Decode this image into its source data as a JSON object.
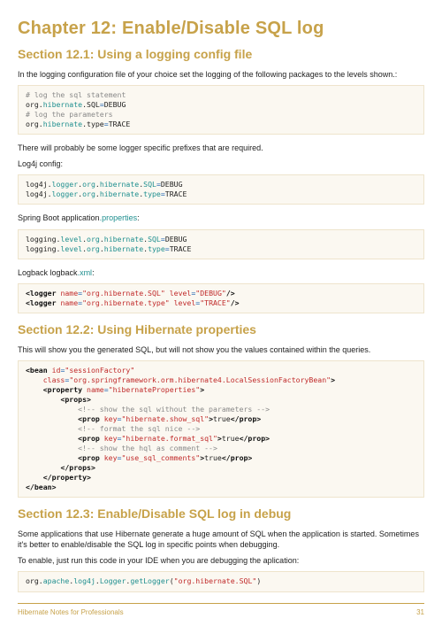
{
  "chapter": {
    "title": "Chapter 12: Enable/Disable SQL log"
  },
  "sections": {
    "s1": {
      "title": "Section 12.1: Using a logging config file",
      "p1": "In the logging configuration file of your choice set the logging of the following packages to the levels shown.:",
      "code1": {
        "l1": "# log the sql statement",
        "l2a": "org.",
        "l2b": "hibernate",
        "l2c": ".SQL",
        "l2d": "=",
        "l2e": "DEBUG",
        "l3": "# log the parameters",
        "l4a": "org.",
        "l4b": "hibernate",
        "l4c": ".type",
        "l4d": "=",
        "l4e": "TRACE"
      },
      "p2": "There will probably be some logger specific prefixes that are required.",
      "p3": "Log4j config:",
      "code2": {
        "l1a": "log4j.",
        "l1b": "logger",
        "l1c": ".",
        "l1d": "org",
        "l1e": ".",
        "l1f": "hibernate",
        "l1g": ".",
        "l1h": "SQL",
        "l1i": "=",
        "l1j": "DEBUG",
        "l2a": "log4j.",
        "l2b": "logger",
        "l2c": ".",
        "l2d": "org",
        "l2e": ".",
        "l2f": "hibernate",
        "l2g": ".",
        "l2h": "type",
        "l2i": "=",
        "l2j": "TRACE"
      },
      "p4a": "Spring Boot application",
      "p4b": ".properties",
      "p4c": ":",
      "code3": {
        "l1a": "logging.",
        "l1b": "level",
        "l1c": ".",
        "l1d": "org",
        "l1e": ".",
        "l1f": "hibernate",
        "l1g": ".",
        "l1h": "SQL",
        "l1i": "=",
        "l1j": "DEBUG",
        "l2a": "logging.",
        "l2b": "level",
        "l2c": ".",
        "l2d": "org",
        "l2e": ".",
        "l2f": "hibernate",
        "l2g": ".",
        "l2h": "type",
        "l2i": "=",
        "l2j": "TRACE"
      },
      "p5a": "Logback logback",
      "p5b": ".xml",
      "p5c": ":",
      "code4": {
        "l1a": "<logger",
        "l1b": " name",
        "l1c": "=",
        "l1d": "\"org.hibernate.SQL\"",
        "l1e": " level",
        "l1f": "=",
        "l1g": "\"DEBUG\"",
        "l1h": "/>",
        "l2a": "<logger",
        "l2b": " name",
        "l2c": "=",
        "l2d": "\"org.hibernate.type\"",
        "l2e": " level",
        "l2f": "=",
        "l2g": "\"TRACE\"",
        "l2h": "/>"
      }
    },
    "s2": {
      "title": "Section 12.2: Using Hibernate properties",
      "p1": "This will show you the generated SQL, but will not show you the values contained within the queries.",
      "code": {
        "l01a": "<bean",
        "l01b": " id",
        "l01c": "=",
        "l01d": "\"sessionFactory\"",
        "l02a": "    class",
        "l02b": "=",
        "l02c": "\"org.springframework.orm.hibernate4.LocalSessionFactoryBean\"",
        "l02d": ">",
        "l03a": "    ",
        "l03b": "<property",
        "l03c": " name",
        "l03d": "=",
        "l03e": "\"hibernateProperties\"",
        "l03f": ">",
        "l04a": "        ",
        "l04b": "<props>",
        "l05a": "            ",
        "l05b": "<!-- show the sql without the parameters -->",
        "l06a": "            ",
        "l06b": "<prop",
        "l06c": " key",
        "l06d": "=",
        "l06e": "\"hibernate.show_sql\"",
        "l06f": ">",
        "l06g": "true",
        "l06h": "</prop>",
        "l07a": "            ",
        "l07b": "<!-- format the sql nice -->",
        "l08a": "            ",
        "l08b": "<prop",
        "l08c": " key",
        "l08d": "=",
        "l08e": "\"hibernate.format_sql\"",
        "l08f": ">",
        "l08g": "true",
        "l08h": "</prop>",
        "l09a": "            ",
        "l09b": "<!-- show the hql as comment -->",
        "l10a": "            ",
        "l10b": "<prop",
        "l10c": " key",
        "l10d": "=",
        "l10e": "\"use_sql_comments\"",
        "l10f": ">",
        "l10g": "true",
        "l10h": "</prop>",
        "l11a": "        ",
        "l11b": "</props>",
        "l12a": "    ",
        "l12b": "</property>",
        "l13": "</bean>"
      }
    },
    "s3": {
      "title": "Section 12.3: Enable/Disable SQL log in debug",
      "p1": "Some applications that use Hibernate generate a huge amount of SQL when the application is started. Sometimes it's better to enable/disable the SQL log in specific points when debugging.",
      "p2": "To enable, just run this code in your IDE when you are debugging the aplication:",
      "code": {
        "l1a": "org.",
        "l1b": "apache",
        "l1c": ".",
        "l1d": "log4j",
        "l1e": ".",
        "l1f": "Logger",
        "l1g": ".",
        "l1h": "getLogger",
        "l1i": "(",
        "l1j": "\"org.hibernate.SQL\"",
        "l1k": ")"
      }
    }
  },
  "footer": {
    "left": "Hibernate Notes for Professionals",
    "right": "31"
  }
}
